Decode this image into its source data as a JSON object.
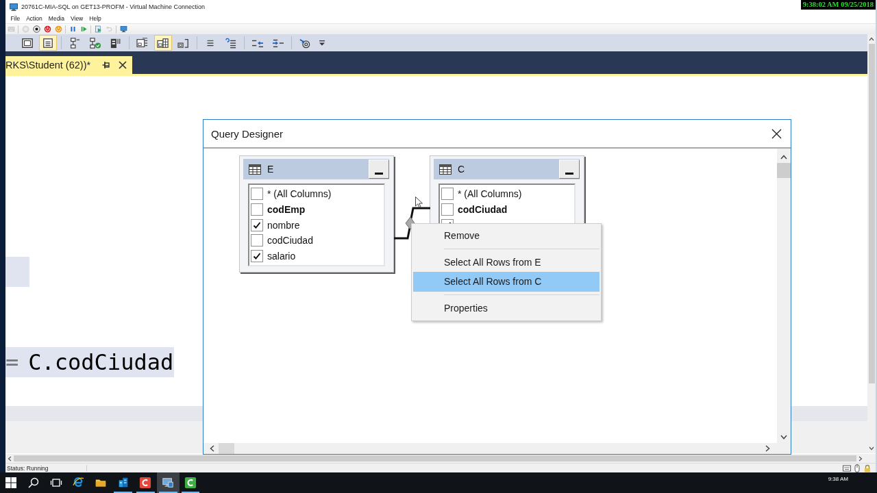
{
  "window": {
    "title": "20761C-MIA-SQL on GET13-PROFM - Virtual Machine Connection"
  },
  "recording_clock": "9:38:02 AM 09/25/2018",
  "menu": [
    "File",
    "Action",
    "Media",
    "View",
    "Help"
  ],
  "vm_toolbar": {
    "groups": [
      {
        "buttons": [
          {
            "disabled": true
          }
        ]
      },
      {
        "buttons": [
          {
            "disabled": true
          },
          {
            "disabled": false
          },
          {
            "disabled": false
          },
          {
            "disabled": false
          }
        ]
      },
      {
        "buttons": [
          {
            "disabled": false
          },
          {
            "disabled": false
          }
        ]
      },
      {
        "buttons": [
          {
            "disabled": false
          },
          {
            "disabled": true
          }
        ]
      },
      {
        "buttons": [
          {
            "disabled": false
          }
        ]
      }
    ]
  },
  "designer_toolbar": {
    "groups": [
      {
        "buttons": [
          {
            "on": false
          },
          {
            "on": true
          }
        ]
      },
      {
        "buttons": [
          {
            "on": false
          },
          {
            "on": false
          },
          {
            "on": false
          }
        ]
      },
      {
        "buttons": [
          {
            "on": false
          },
          {
            "on": true
          },
          {
            "on": false
          }
        ]
      },
      {
        "buttons": [
          {
            "on": false
          },
          {
            "on": false
          }
        ]
      },
      {
        "buttons": [
          {
            "on": false
          },
          {
            "on": false
          }
        ]
      },
      {
        "buttons": [
          {
            "on": false
          }
        ]
      }
    ]
  },
  "document_tab": {
    "label": "RKS\\Student (62))*",
    "selected": true
  },
  "editor": {
    "lines": [
      {
        "selected": false
      },
      {
        "selected": false
      },
      {
        "selected": false
      },
      {
        "selected": false
      },
      {
        "selected": false
      },
      {
        "selected": false
      },
      {
        "selected": true
      },
      {
        "selected": false
      },
      {
        "selected": false
      },
      {
        "selected": true,
        "tokens": [
          {
            "text": "=",
            "kind": "operator"
          },
          {
            "text": "C.codCiudad",
            "kind": "identifier"
          }
        ]
      }
    ]
  },
  "query_designer": {
    "title": "Query Designer",
    "tables": [
      {
        "name": "E",
        "columns": [
          {
            "name": "* (All Columns)",
            "checked": false,
            "key": false
          },
          {
            "name": "codEmp",
            "checked": false,
            "key": true
          },
          {
            "name": "nombre",
            "checked": true,
            "key": false
          },
          {
            "name": "codCiudad",
            "checked": false,
            "key": false
          },
          {
            "name": "salario",
            "checked": true,
            "key": false
          }
        ]
      },
      {
        "name": "C",
        "columns": [
          {
            "name": "* (All Columns)",
            "checked": false,
            "key": false
          },
          {
            "name": "codCiudad",
            "checked": false,
            "key": true
          },
          {
            "checked": true
          }
        ]
      }
    ],
    "context_menu": {
      "sections": [
        {
          "items": [
            {
              "label": "Remove",
              "selected": false
            }
          ]
        },
        {
          "items": [
            {
              "label": "Select All Rows from E",
              "selected": false
            },
            {
              "label": "Select All Rows from C",
              "selected": true
            }
          ]
        },
        {
          "items": [
            {
              "label": "Properties",
              "selected": false
            }
          ]
        }
      ]
    }
  },
  "status_bar": {
    "text": "Status: Running"
  },
  "taskbar": {
    "apps": [
      {
        "running": false,
        "selected": false
      },
      {
        "running": false,
        "selected": false
      },
      {
        "running": true,
        "selected": false
      },
      {
        "running": true,
        "selected": false
      },
      {
        "running": true,
        "selected": true
      },
      {
        "running": true,
        "selected": false
      }
    ],
    "clock": "9:38 AM"
  }
}
